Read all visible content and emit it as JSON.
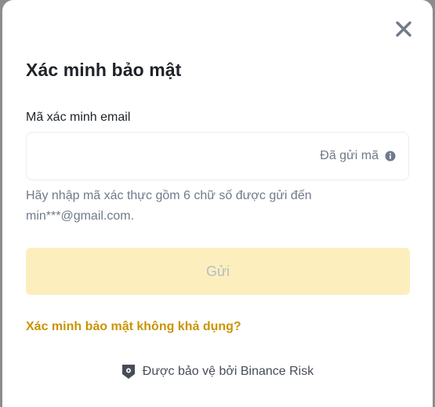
{
  "dialog": {
    "title": "Xác minh bảo mật",
    "close_icon": "close-icon"
  },
  "email_code": {
    "label": "Mã xác minh email",
    "value": "",
    "placeholder": "",
    "sent_status": "Đã gửi mã",
    "status_icon": "info-icon",
    "helper_text": "Hãy nhập mã xác thực gồm 6 chữ số được gửi đến min***@gmail.com."
  },
  "submit": {
    "label": "Gửi",
    "enabled": false
  },
  "links": {
    "unavailable": "Xác minh bảo mật không khả dụng?"
  },
  "footer": {
    "icon": "shield-icon",
    "text": "Được bảo vệ bởi Binance Risk"
  },
  "colors": {
    "accent_link": "#c99400",
    "button_disabled_bg": "#fcefbd",
    "button_disabled_text": "#b7bdc6",
    "title_text": "#1e2329",
    "secondary_text": "#707a8a",
    "backdrop": "#8c8c8c"
  }
}
